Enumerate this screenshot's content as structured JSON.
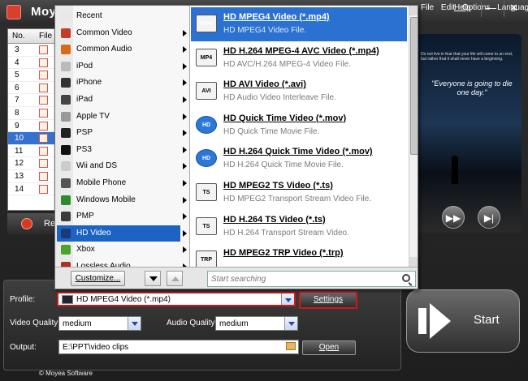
{
  "app": {
    "title": "Moye",
    "menu": [
      "File",
      "Edit",
      "Options",
      "Languages"
    ],
    "help": "Help",
    "minimize": "—",
    "close": "✕"
  },
  "file_list": {
    "header_no": "No.",
    "header_name": "File N",
    "rows": [
      "3",
      "4",
      "5",
      "6",
      "7",
      "8",
      "9",
      "10",
      "11",
      "12",
      "13",
      "14"
    ],
    "selected_row": "10"
  },
  "remove_label": "Rem",
  "preview": {
    "quote": "Do not live in fear that your life will come to an end, but rather that it shall never have a beginning.",
    "caption": "\"Everyone is going to die one day.\""
  },
  "popup": {
    "categories": [
      {
        "label": "Recent",
        "icon_color": "#e8e8e8"
      },
      {
        "label": "Common Video",
        "icon_color": "#c33b2a"
      },
      {
        "label": "Common Audio",
        "icon_color": "#d86a1e"
      },
      {
        "label": "iPod",
        "icon_color": "#bbbbbb"
      },
      {
        "label": "iPhone",
        "icon_color": "#333333"
      },
      {
        "label": "iPad",
        "icon_color": "#444444"
      },
      {
        "label": "Apple TV",
        "icon_color": "#999999"
      },
      {
        "label": "PSP",
        "icon_color": "#222222"
      },
      {
        "label": "PS3",
        "icon_color": "#111111"
      },
      {
        "label": "Wii and DS",
        "icon_color": "#cccccc"
      },
      {
        "label": "Mobile Phone",
        "icon_color": "#555555"
      },
      {
        "label": "Windows Mobile",
        "icon_color": "#2d8a2d"
      },
      {
        "label": "PMP",
        "icon_color": "#3b3b3b"
      },
      {
        "label": "HD Video",
        "icon_color": "#1a3a7a"
      },
      {
        "label": "Xbox",
        "icon_color": "#4aa42a"
      },
      {
        "label": "Lossless Audio",
        "icon_color": "#aa3322"
      }
    ],
    "selected_category": "HD Video",
    "formats": [
      {
        "name": "HD MPEG4 Video (*.mp4)",
        "desc": "HD MPEG4 Video File.",
        "icon_text": "MP4",
        "icon": "mp4-file-icon"
      },
      {
        "name": "HD H.264 MPEG-4 AVC Video (*.mp4)",
        "desc": "HD AVC/H.264 MPEG-4 Video File.",
        "icon_text": "MP4",
        "icon": "mp4-file-icon"
      },
      {
        "name": "HD AVI Video (*.avi)",
        "desc": "HD Audio Video Interleave File.",
        "icon_text": "AVI",
        "icon": "avi-file-icon"
      },
      {
        "name": "HD Quick Time Video (*.mov)",
        "desc": "HD Quick Time Movie File.",
        "icon_text": "HD",
        "icon": "quicktime-icon"
      },
      {
        "name": "HD H.264 Quick Time Video (*.mov)",
        "desc": "HD H.264 Quick Time Movie File.",
        "icon_text": "HD",
        "icon": "quicktime-icon"
      },
      {
        "name": "HD MPEG2 TS Video (*.ts)",
        "desc": "HD MPEG2 Transport Stream Video File.",
        "icon_text": "TS",
        "icon": "ts-file-icon"
      },
      {
        "name": "HD H.264 TS Video (*.ts)",
        "desc": "HD H.264 Transport Stream Video.",
        "icon_text": "TS",
        "icon": "ts-file-icon"
      },
      {
        "name": "HD MPEG2 TRP Video (*.trp)",
        "desc": "",
        "icon_text": "TRP",
        "icon": "trp-file-icon"
      }
    ],
    "customize_label": "Customize...",
    "search_placeholder": "Start searching"
  },
  "bottom": {
    "profile_label": "Profile:",
    "profile_value": "HD MPEG4 Video (*.mp4)",
    "settings_label": "Settings",
    "video_quality_label": "Video Quality:",
    "video_quality_value": "medium",
    "audio_quality_label": "Audio Quality:",
    "audio_quality_value": "medium",
    "output_label": "Output:",
    "output_value": "E:\\PPT\\video clips",
    "open_label": "Open",
    "start_label": "Start",
    "copyright": "© Moyea Software"
  },
  "colors": {
    "selection_blue": "#2a71d2",
    "highlight_red": "#d01818"
  }
}
